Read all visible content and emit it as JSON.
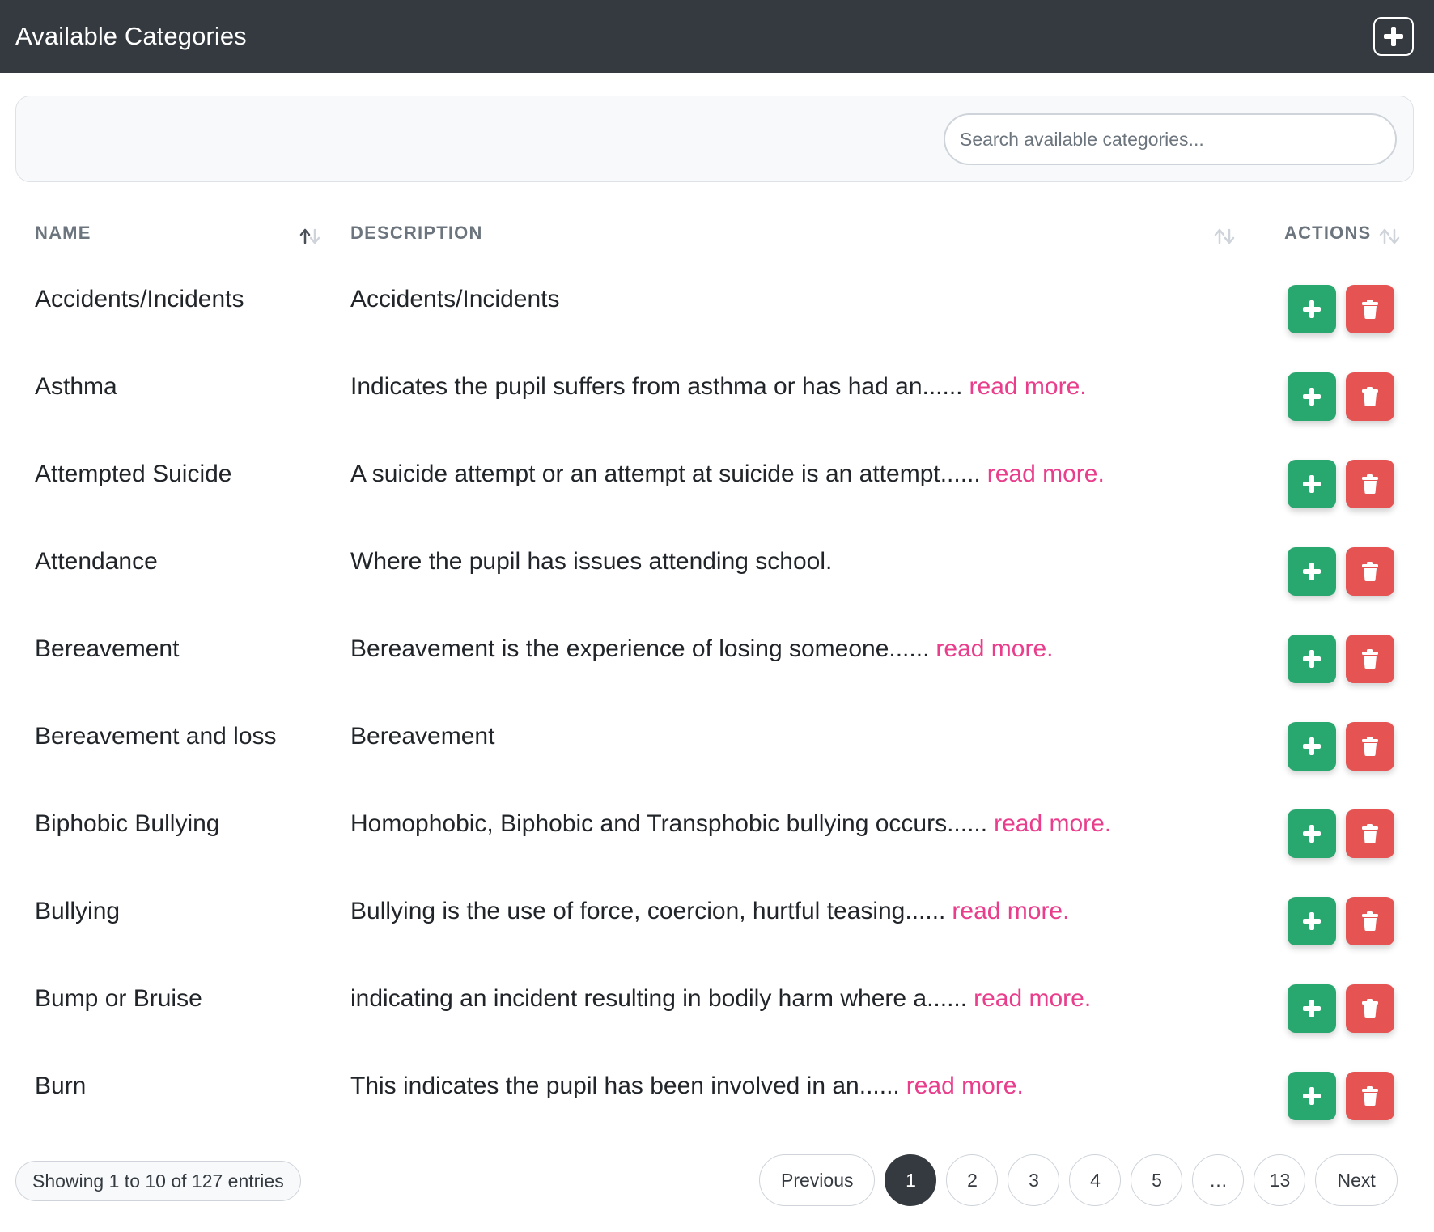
{
  "header": {
    "title": "Available Categories",
    "add_icon": "plus-icon"
  },
  "search": {
    "placeholder": "Search available categories...",
    "value": ""
  },
  "table": {
    "columns": {
      "name": "NAME",
      "description": "DESCRIPTION",
      "actions": "ACTIONS"
    },
    "read_more_label": "read more.",
    "rows": [
      {
        "name": "Accidents/Incidents",
        "description": "Accidents/Incidents",
        "truncated": false
      },
      {
        "name": "Asthma",
        "description": "Indicates the pupil suffers from asthma or has had an......",
        "truncated": true
      },
      {
        "name": "Attempted Suicide",
        "description": "A suicide attempt or an attempt at suicide is an attempt......",
        "truncated": true
      },
      {
        "name": "Attendance",
        "description": "Where the pupil has issues attending school.",
        "truncated": false
      },
      {
        "name": "Bereavement",
        "description": "Bereavement is the experience of losing someone......",
        "truncated": true
      },
      {
        "name": "Bereavement and loss",
        "description": "Bereavement",
        "truncated": false
      },
      {
        "name": "Biphobic Bullying",
        "description": "Homophobic, Biphobic and Transphobic bullying occurs......",
        "truncated": true
      },
      {
        "name": "Bullying",
        "description": "Bullying is the use of force, coercion, hurtful teasing......",
        "truncated": true
      },
      {
        "name": "Bump or Bruise",
        "description": "indicating an incident resulting in bodily harm where a......",
        "truncated": true
      },
      {
        "name": "Burn",
        "description": "This indicates the pupil has been involved in an......",
        "truncated": true
      }
    ]
  },
  "footer": {
    "info": "Showing 1 to 10 of 127 entries",
    "pagination": {
      "previous": "Previous",
      "next": "Next",
      "pages": [
        "1",
        "2",
        "3",
        "4",
        "5",
        "…",
        "13"
      ],
      "current": "1"
    }
  },
  "colors": {
    "header_bg": "#343a40",
    "add_button": "#28a76f",
    "delete_button": "#e55353",
    "read_more": "#e83e8c"
  }
}
